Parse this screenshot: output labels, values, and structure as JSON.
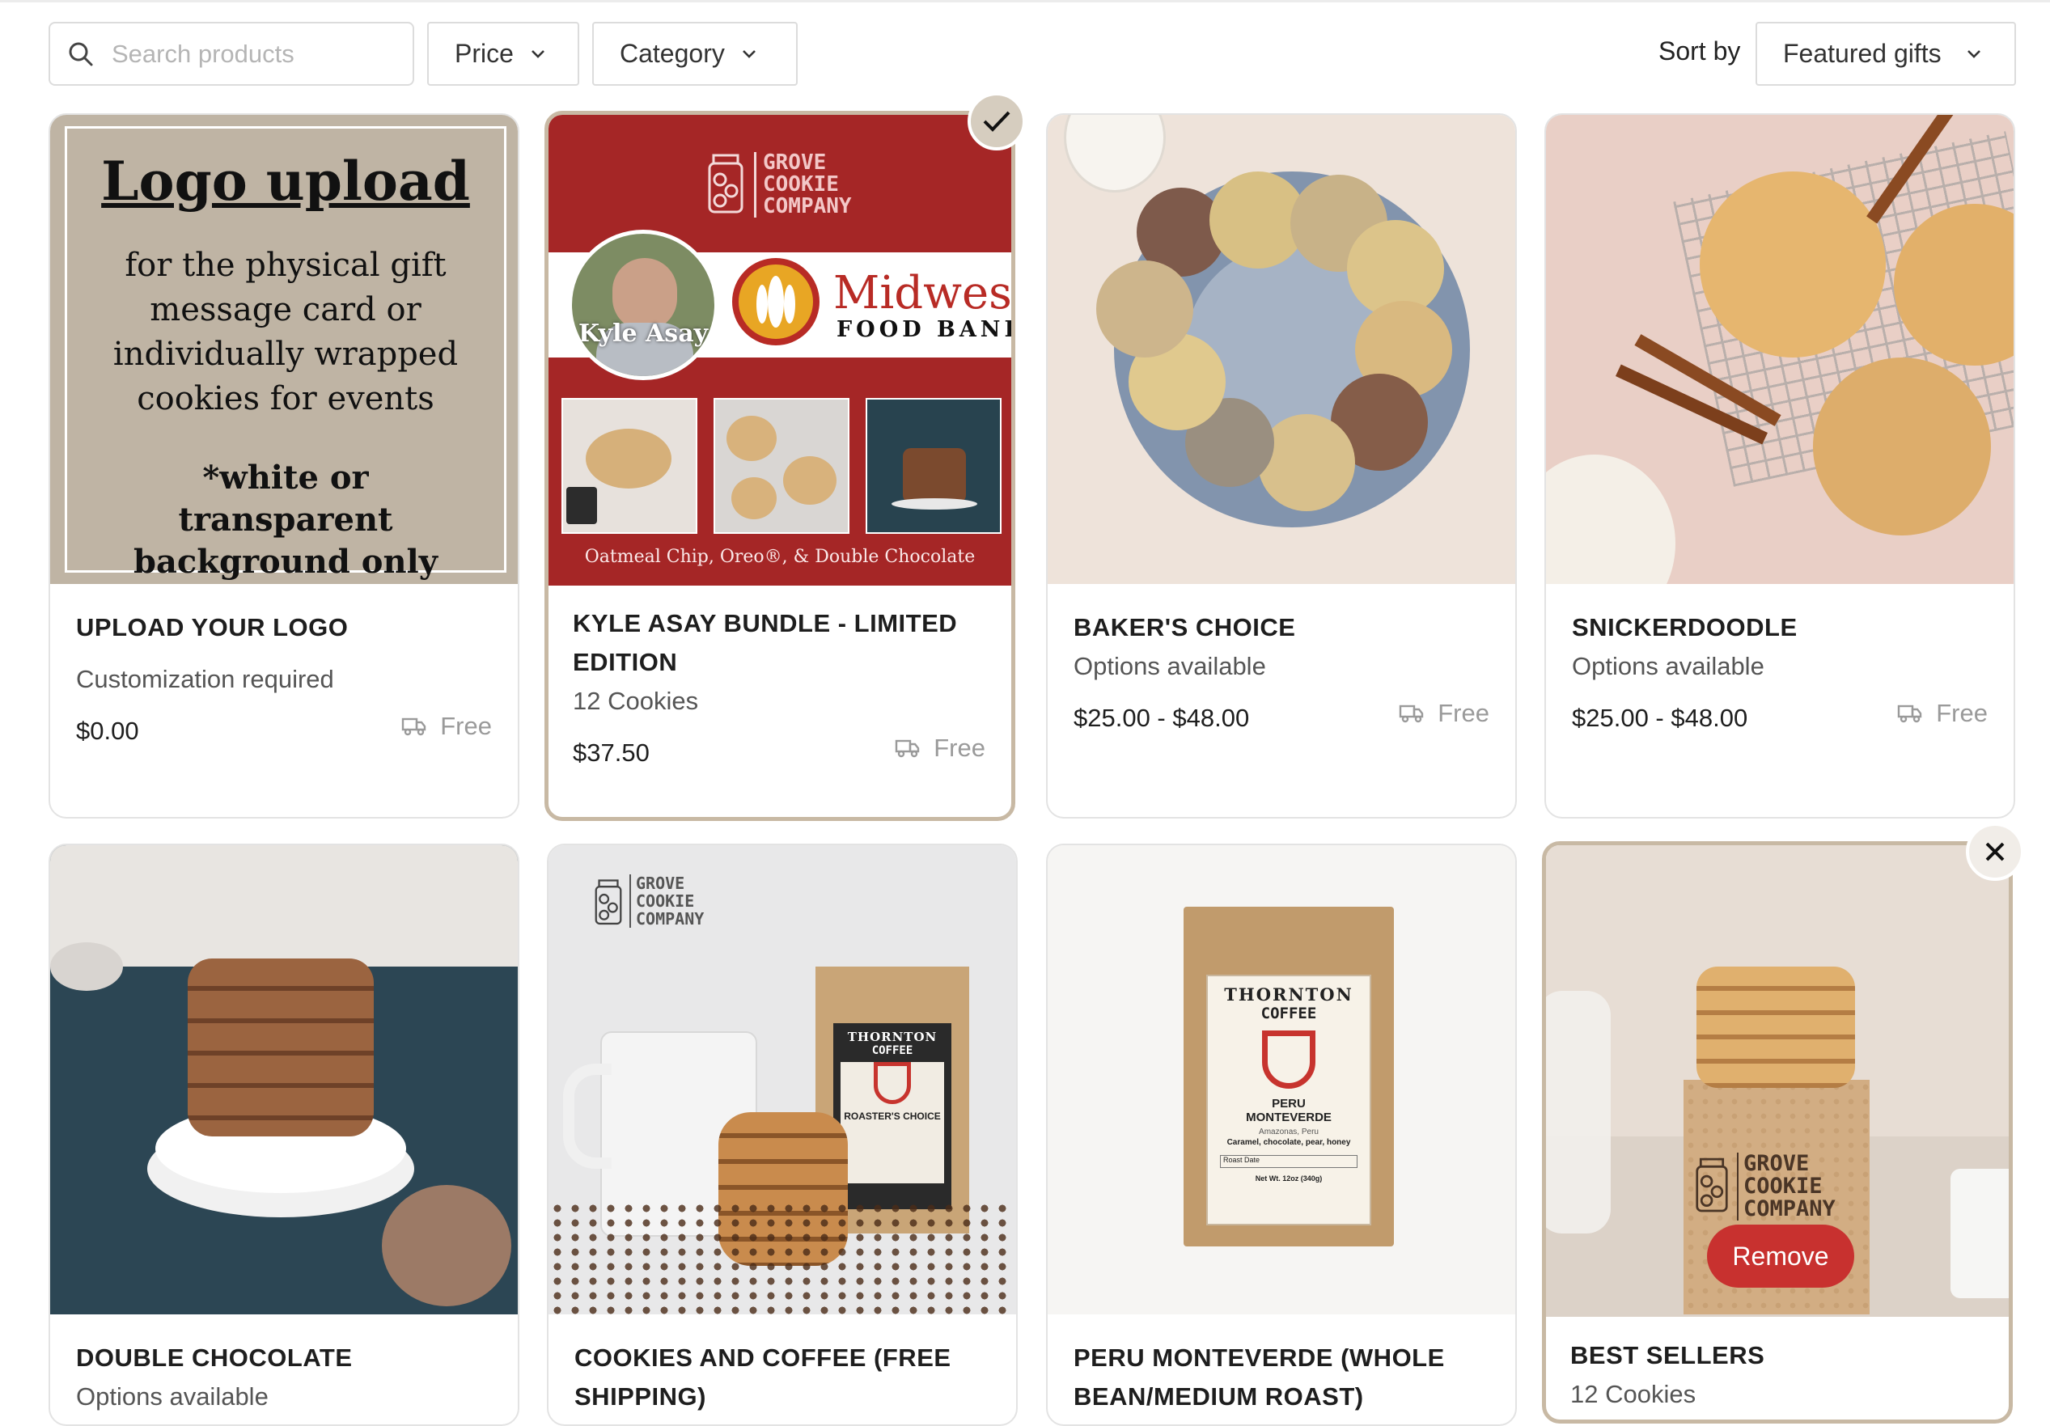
{
  "toolbar": {
    "search_placeholder": "Search products",
    "price_label": "Price",
    "category_label": "Category",
    "sort_label": "Sort by",
    "sort_value": "Featured gifts"
  },
  "colors": {
    "accent_red": "#c8312f",
    "selected_border": "#c8b9a4",
    "logo_bg": "#bfb4a4",
    "banner_red": "#a52626"
  },
  "cards": [
    {
      "title": "UPLOAD YOUR LOGO",
      "subtitle": "Customization required",
      "price": "$0.00",
      "shipping": "Free",
      "image": {
        "heading": "Logo upload",
        "body": "for the physical gift message card or individually wrapped cookies for events",
        "note": "*white or transparent background only"
      }
    },
    {
      "title": "KYLE ASAY BUNDLE - LIMITED EDITION",
      "subtitle": "12 Cookies",
      "price": "$37.50",
      "shipping": "Free",
      "selected": true,
      "image": {
        "brand": "GROVE COOKIE COMPANY",
        "person": "Kyle Asay",
        "partner_big": "Midwest",
        "partner_small": "FOOD BANK.",
        "caption": "Oatmeal Chip, Oreo®, & Double Chocolate"
      }
    },
    {
      "title": "BAKER'S CHOICE",
      "subtitle": "Options available",
      "price": "$25.00 - $48.00",
      "shipping": "Free"
    },
    {
      "title": "SNICKERDOODLE",
      "subtitle": "Options available",
      "price": "$25.00 - $48.00",
      "shipping": "Free"
    },
    {
      "title": "DOUBLE CHOCOLATE",
      "subtitle": "Options available"
    },
    {
      "title": "COOKIES AND COFFEE (FREE SHIPPING)",
      "image": {
        "brand": "GROVE COOKIE COMPANY",
        "bag_brand": "THORNTON",
        "bag_sub": "COFFEE",
        "bag_label": "ROASTER'S CHOICE"
      }
    },
    {
      "title": "PERU MONTEVERDE (WHOLE BEAN/MEDIUM ROAST)",
      "image": {
        "bag_brand": "THORNTON",
        "bag_sub": "COFFEE",
        "bag_label": "PERU MONTEVERDE",
        "bag_origin": "Amazonas, Peru",
        "bag_notes": "Caramel, chocolate, pear, honey",
        "bag_date": "Roast Date",
        "bag_weight": "Net Wt. 12oz (340g)"
      }
    },
    {
      "title": "BEST SELLERS",
      "subtitle": "12 Cookies",
      "remove_label": "Remove",
      "image": {
        "brand": "GROVE COOKIE COMPANY"
      }
    }
  ]
}
